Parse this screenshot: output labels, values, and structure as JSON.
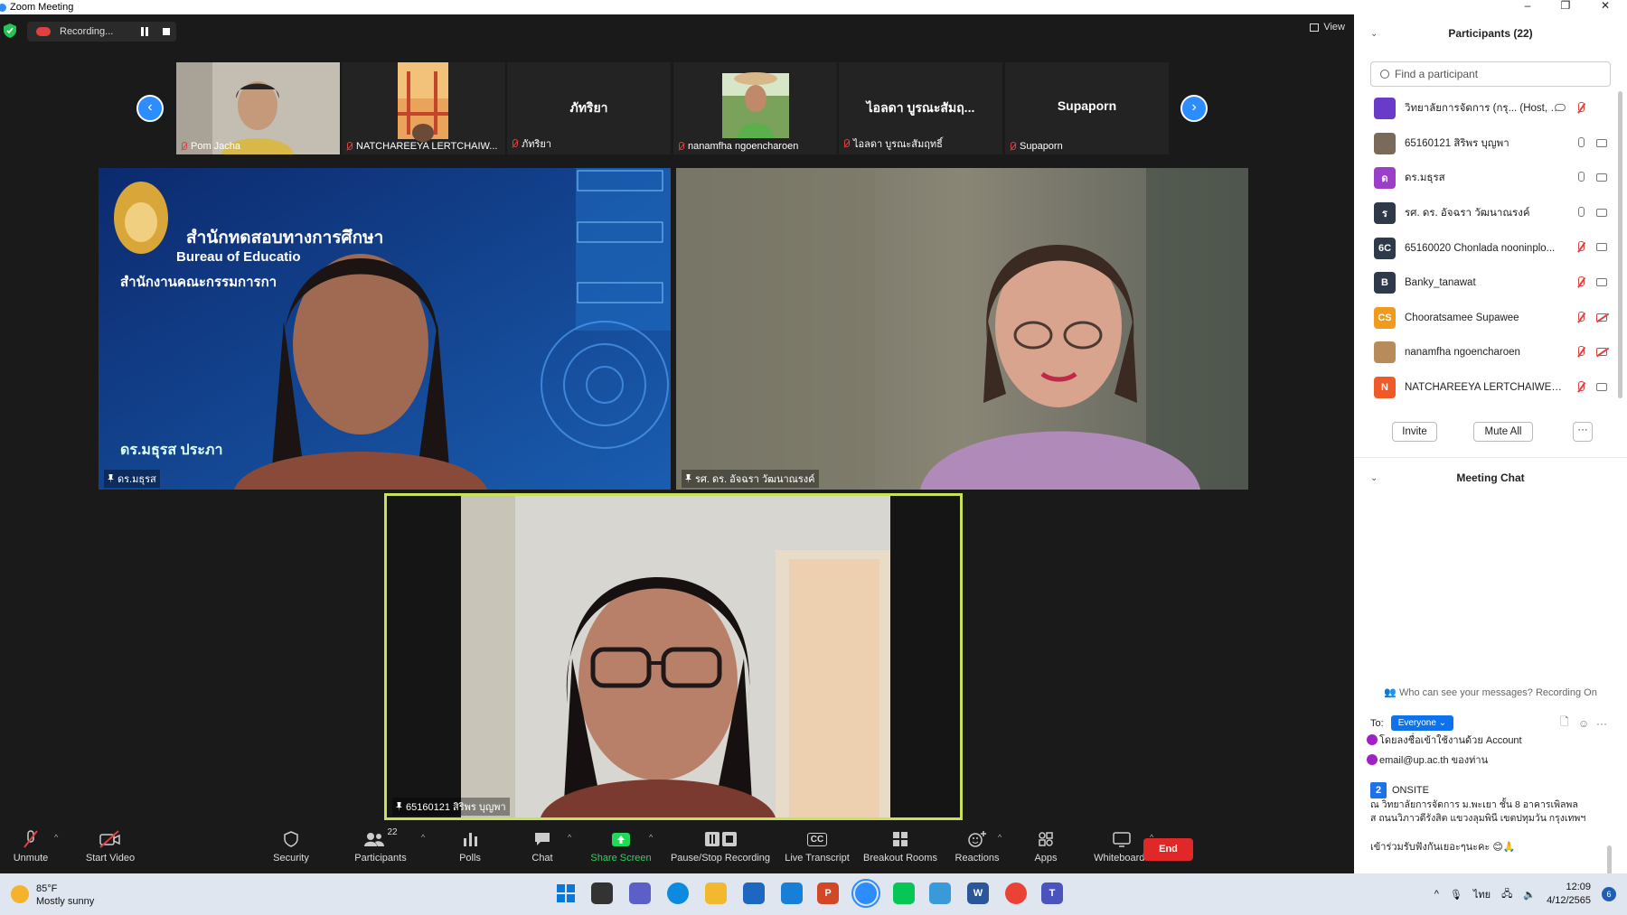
{
  "window": {
    "title": "Zoom Meeting"
  },
  "topbar": {
    "recording_label": "Recording...",
    "view_label": "View"
  },
  "thumbnails": [
    {
      "label": "Pom Jacha",
      "center_name": ""
    },
    {
      "label": "NATCHAREEYA LERTCHAIW...",
      "center_name": ""
    },
    {
      "label": "ภัทริยา",
      "center_name": "ภัทริยา"
    },
    {
      "label": "nanamfha ngoencharoen",
      "center_name": ""
    },
    {
      "label": "ไอลดา บูรณะสัมฤทธิ์",
      "center_name": "ไอลดา บูรณะสัมฤ..."
    },
    {
      "label": "Supaporn",
      "center_name": "Supaporn"
    }
  ],
  "videos": {
    "left": {
      "label": "ดร.มธุรส",
      "bg_title_th": "สำนักทดสอบทางการศึกษา",
      "bg_title_en": "Bureau of Educatio",
      "bg_subtitle_th": "สำนักงานคณะกรรมการกา",
      "bg_name_th": "ดร.มธุรส ประภา"
    },
    "right": {
      "label": "รศ. ดร. อัจฉรา วัฒนาณรงค์"
    },
    "active": {
      "label": "65160121 สิริพร บุญพา"
    }
  },
  "toolbar": {
    "unmute": "Unmute",
    "start_video": "Start Video",
    "security": "Security",
    "participants": "Participants",
    "participants_count": "22",
    "polls": "Polls",
    "chat": "Chat",
    "share_screen": "Share Screen",
    "pause_recording": "Pause/Stop Recording",
    "live_transcript": "Live Transcript",
    "live_transcript_icon": "CC",
    "breakout_rooms": "Breakout Rooms",
    "reactions": "Reactions",
    "apps": "Apps",
    "whiteboards": "Whiteboards",
    "end": "End"
  },
  "participants_panel": {
    "title": "Participants (22)",
    "search_placeholder": "Find a participant",
    "items": [
      {
        "name": "วิทยาลัยการจัดการ (กรุ... (Host, me)",
        "avatar": "",
        "color": "#6a3ac8",
        "mic": "off",
        "cam": "none"
      },
      {
        "name": "65160121 สิริพร  บุญพา",
        "avatar": "",
        "color": "#7a6a5a",
        "mic": "on",
        "cam": "on"
      },
      {
        "name": "ดร.มธุรส",
        "avatar": "ด",
        "color": "#9b3fc8",
        "mic": "on",
        "cam": "on"
      },
      {
        "name": "รศ. ดร. อัจฉรา  วัฒนาณรงค์",
        "avatar": "ร",
        "color": "#2e3a4a",
        "mic": "on",
        "cam": "on"
      },
      {
        "name": "65160020 Chonlada nooninplo...",
        "avatar": "6C",
        "color": "#2e3a4a",
        "mic": "off",
        "cam": "on"
      },
      {
        "name": "Banky_tanawat",
        "avatar": "B",
        "color": "#2e3a4a",
        "mic": "off",
        "cam": "on"
      },
      {
        "name": "Chooratsamee Supawee",
        "avatar": "CS",
        "color": "#f29a1c",
        "mic": "off",
        "cam": "off"
      },
      {
        "name": "nanamfha ngoencharoen",
        "avatar": "",
        "color": "#b78b5a",
        "mic": "off",
        "cam": "off"
      },
      {
        "name": "NATCHAREEYA LERTCHAIWEER...",
        "avatar": "N",
        "color": "#f05a28",
        "mic": "off",
        "cam": "on"
      }
    ],
    "invite": "Invite",
    "mute_all": "Mute All",
    "more": "···"
  },
  "chat_panel": {
    "title": "Meeting Chat",
    "visibility_note": "Who can see your messages? Recording On",
    "to_label": "To:",
    "to_value": "Everyone",
    "messages": {
      "line1": "โดยลงชื่อเข้าใช้งานด้วย Account",
      "line2": "email@up.ac.th ของท่าน",
      "onsite_num": "2",
      "onsite": "ONSITE",
      "addr1": "ณ วิทยาลัยการจัดการ ม.พะเยา ชั้น 8 อาคารเพิลพล",
      "addr2": "ส ถนนวิภาวดีรังสิต แขวงลุมพินี เขตปทุมวัน กรุงเทพฯ",
      "welcome": "เข้าร่วมรับฟังกันเยอะๆนะคะ 😊🙏"
    }
  },
  "taskbar": {
    "temperature": "85°F",
    "weather": "Mostly sunny",
    "language": "ไทย",
    "time": "12:09",
    "date": "4/12/2565",
    "notifications": "6"
  }
}
